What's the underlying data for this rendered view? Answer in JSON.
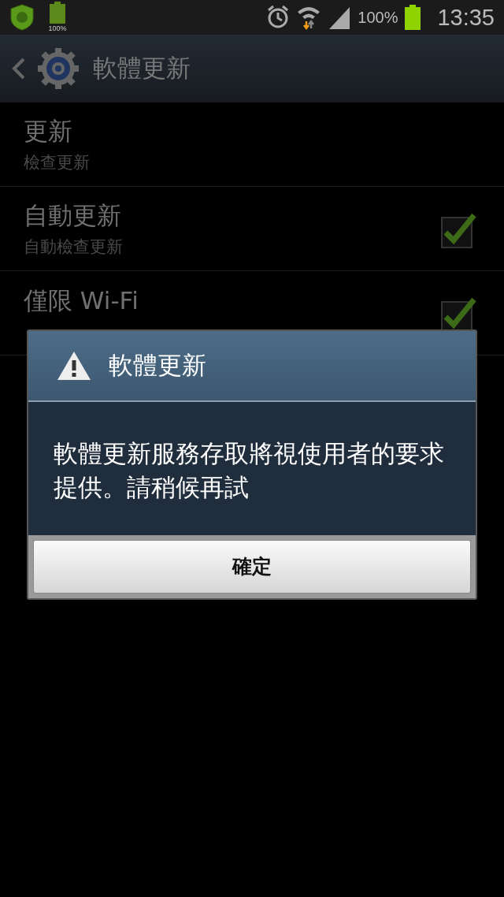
{
  "status_bar": {
    "battery_label": "100%",
    "battery_percent": "100%",
    "time": "13:35"
  },
  "action_bar": {
    "title": "軟體更新"
  },
  "settings": [
    {
      "kind": "plain",
      "title": "更新",
      "summary": "檢查更新"
    },
    {
      "kind": "checkbox",
      "title": "自動更新",
      "summary": "自動檢查更新",
      "checked": true
    },
    {
      "kind": "checkbox",
      "title": "僅限 Wi-Fi",
      "checked": true
    }
  ],
  "dialog": {
    "title": "軟體更新",
    "message": "軟體更新服務存取將視使用者的要求提供。請稍候再試",
    "buttons": [
      "確定"
    ]
  }
}
